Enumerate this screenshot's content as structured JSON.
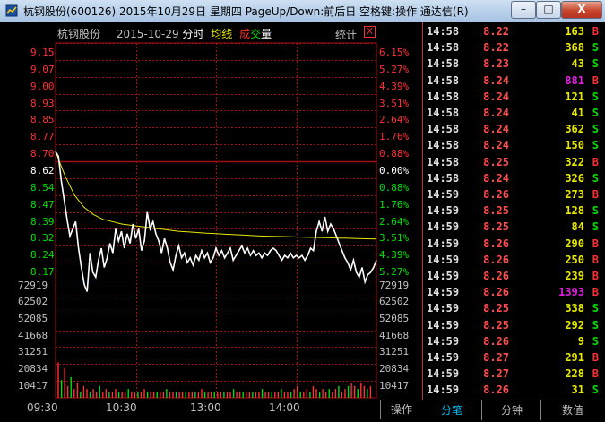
{
  "window": {
    "title": "杭钢股份(600126) 2015年10月29日 星期四 PageUp/Down:前后日 空格键:操作 通达信(R)",
    "min_label": "–",
    "max_label": "□",
    "close_label": "X"
  },
  "chart_header": {
    "stock_name": "杭钢股份",
    "date": "2015-10-29",
    "label_fenshi": "分时",
    "label_junxian": "均线",
    "label_cheng": "成",
    "label_jiao": "交",
    "label_liang": "量",
    "stats_label": "统计",
    "close_label": "X"
  },
  "colors": {
    "price_line": "#ffffff",
    "avg_line": "#e8e800",
    "up": "#ff3030",
    "down": "#00e000",
    "neutral": "#ffffff",
    "grid": "#a01010"
  },
  "price_axis": [
    "9.15",
    "9.07",
    "9.00",
    "8.93",
    "8.85",
    "8.77",
    "8.70",
    "8.62",
    "8.54",
    "8.47",
    "8.39",
    "8.32",
    "8.24",
    "8.17"
  ],
  "pct_axis": [
    "6.15%",
    "5.27%",
    "4.39%",
    "3.51%",
    "2.64%",
    "1.76%",
    "0.88%",
    "0.00%",
    "0.88%",
    "1.76%",
    "2.64%",
    "3.51%",
    "4.39%",
    "5.27%"
  ],
  "volume_axis": [
    "72919",
    "62502",
    "52085",
    "41668",
    "31251",
    "20834",
    "10417"
  ],
  "time_axis": [
    "09:30",
    "10:30",
    "13:00",
    "14:00"
  ],
  "chart_data": {
    "type": "line",
    "prev_close": 8.62,
    "ylim": [
      8.17,
      9.15
    ],
    "series": [
      {
        "name": "分时",
        "values": [
          8.7,
          8.68,
          8.58,
          8.5,
          8.42,
          8.35,
          8.38,
          8.41,
          8.3,
          8.22,
          8.15,
          8.12,
          8.28,
          8.2,
          8.18,
          8.25,
          8.3,
          8.22,
          8.26,
          8.32,
          8.28,
          8.38,
          8.33,
          8.37,
          8.3,
          8.36,
          8.32,
          8.4,
          8.34,
          8.38,
          8.29,
          8.33,
          8.45,
          8.38,
          8.41,
          8.36,
          8.33,
          8.28,
          8.34,
          8.3,
          8.24,
          8.21,
          8.27,
          8.31,
          8.26,
          8.28,
          8.24,
          8.26,
          8.23,
          8.27,
          8.25,
          8.29,
          8.26,
          8.28,
          8.24,
          8.26,
          8.3,
          8.27,
          8.29,
          8.26,
          8.28,
          8.3,
          8.25,
          8.27,
          8.29,
          8.31,
          8.28,
          8.3,
          8.27,
          8.29,
          8.27,
          8.28,
          8.26,
          8.28,
          8.27,
          8.29,
          8.3,
          8.29,
          8.27,
          8.25,
          8.27,
          8.26,
          8.28,
          8.26,
          8.27,
          8.26,
          8.27,
          8.25,
          8.27,
          8.3,
          8.29,
          8.37,
          8.41,
          8.37,
          8.43,
          8.37,
          8.4,
          8.38,
          8.35,
          8.32,
          8.29,
          8.26,
          8.24,
          8.21,
          8.25,
          8.2,
          8.18,
          8.22,
          8.16,
          8.19,
          8.2,
          8.22,
          8.25
        ]
      },
      {
        "name": "均线",
        "values": [
          8.7,
          8.6,
          8.52,
          8.47,
          8.44,
          8.42,
          8.41,
          8.4,
          8.395,
          8.39,
          8.385,
          8.38,
          8.375,
          8.37,
          8.368,
          8.365,
          8.362,
          8.36,
          8.358,
          8.356,
          8.354,
          8.352,
          8.35,
          8.349,
          8.348,
          8.347,
          8.346,
          8.345,
          8.344,
          8.343,
          8.342,
          8.341,
          8.34,
          8.339,
          8.338
        ]
      }
    ],
    "volumes": [
      12,
      6,
      10,
      4,
      7,
      3,
      5,
      2,
      4,
      3,
      2,
      3,
      2,
      4,
      2,
      3,
      2,
      2,
      3,
      2,
      2,
      2,
      3,
      2,
      2,
      2,
      2,
      3,
      2,
      2,
      2,
      2,
      2,
      2,
      3,
      2,
      2,
      2,
      2,
      2,
      2,
      2,
      2,
      2,
      2,
      3,
      2,
      2,
      2,
      2,
      2,
      2,
      2,
      2,
      2,
      3,
      2,
      2,
      2,
      2,
      2,
      2,
      2,
      2,
      3,
      2,
      2,
      2,
      2,
      2,
      3,
      2,
      2,
      2,
      3,
      4,
      2,
      2,
      3,
      2,
      4,
      3,
      2,
      3,
      2,
      3,
      2,
      3,
      4,
      2,
      3,
      4,
      5,
      4,
      3,
      5,
      4,
      3,
      4
    ]
  },
  "ticks": [
    {
      "time": "14:58",
      "price": "8.22",
      "vol": "163",
      "side": "B"
    },
    {
      "time": "14:58",
      "price": "8.22",
      "vol": "368",
      "side": "S"
    },
    {
      "time": "14:58",
      "price": "8.23",
      "vol": "43",
      "side": "S"
    },
    {
      "time": "14:58",
      "price": "8.24",
      "vol": "881",
      "side": "B"
    },
    {
      "time": "14:58",
      "price": "8.24",
      "vol": "121",
      "side": "S"
    },
    {
      "time": "14:58",
      "price": "8.24",
      "vol": "41",
      "side": "S"
    },
    {
      "time": "14:58",
      "price": "8.24",
      "vol": "362",
      "side": "S"
    },
    {
      "time": "14:58",
      "price": "8.24",
      "vol": "150",
      "side": "S"
    },
    {
      "time": "14:58",
      "price": "8.25",
      "vol": "322",
      "side": "B"
    },
    {
      "time": "14:58",
      "price": "8.24",
      "vol": "326",
      "side": "S"
    },
    {
      "time": "14:59",
      "price": "8.26",
      "vol": "273",
      "side": "B"
    },
    {
      "time": "14:59",
      "price": "8.25",
      "vol": "128",
      "side": "S"
    },
    {
      "time": "14:59",
      "price": "8.25",
      "vol": "84",
      "side": "S"
    },
    {
      "time": "14:59",
      "price": "8.26",
      "vol": "290",
      "side": "B"
    },
    {
      "time": "14:59",
      "price": "8.26",
      "vol": "250",
      "side": "B"
    },
    {
      "time": "14:59",
      "price": "8.26",
      "vol": "239",
      "side": "B"
    },
    {
      "time": "14:59",
      "price": "8.26",
      "vol": "1393",
      "side": "B"
    },
    {
      "time": "14:59",
      "price": "8.25",
      "vol": "338",
      "side": "S"
    },
    {
      "time": "14:59",
      "price": "8.25",
      "vol": "292",
      "side": "S"
    },
    {
      "time": "14:59",
      "price": "8.26",
      "vol": "9",
      "side": "S"
    },
    {
      "time": "14:59",
      "price": "8.27",
      "vol": "291",
      "side": "B"
    },
    {
      "time": "14:59",
      "price": "8.27",
      "vol": "228",
      "side": "B"
    },
    {
      "time": "14:59",
      "price": "8.26",
      "vol": "31",
      "side": "S"
    }
  ],
  "bottom_tabs": {
    "operate": "操作",
    "fenbi": "分笔",
    "fenzhong": "分钟",
    "shuzhi": "数值"
  }
}
